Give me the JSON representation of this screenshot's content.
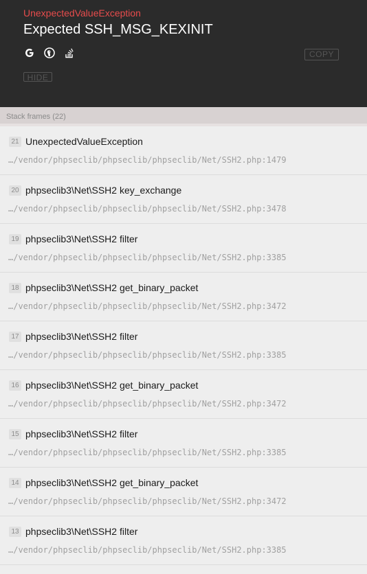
{
  "header": {
    "exception_class": "UnexpectedValueException",
    "exception_message": "Expected SSH_MSG_KEXINIT",
    "search_icons": [
      "google-icon",
      "duckduckgo-icon",
      "stackoverflow-icon"
    ],
    "copy_label": "COPY",
    "hide_label": "HIDE"
  },
  "stack": {
    "title": "Stack frames (22)",
    "frames": [
      {
        "index": "21",
        "title": "UnexpectedValueException",
        "file": "…/vendor/phpseclib/phpseclib/phpseclib/Net/SSH2.php:1479"
      },
      {
        "index": "20",
        "title": "phpseclib3\\Net\\SSH2 key_exchange",
        "file": "…/vendor/phpseclib/phpseclib/phpseclib/Net/SSH2.php:3478"
      },
      {
        "index": "19",
        "title": "phpseclib3\\Net\\SSH2 filter",
        "file": "…/vendor/phpseclib/phpseclib/phpseclib/Net/SSH2.php:3385"
      },
      {
        "index": "18",
        "title": "phpseclib3\\Net\\SSH2 get_binary_packet",
        "file": "…/vendor/phpseclib/phpseclib/phpseclib/Net/SSH2.php:3472"
      },
      {
        "index": "17",
        "title": "phpseclib3\\Net\\SSH2 filter",
        "file": "…/vendor/phpseclib/phpseclib/phpseclib/Net/SSH2.php:3385"
      },
      {
        "index": "16",
        "title": "phpseclib3\\Net\\SSH2 get_binary_packet",
        "file": "…/vendor/phpseclib/phpseclib/phpseclib/Net/SSH2.php:3472"
      },
      {
        "index": "15",
        "title": "phpseclib3\\Net\\SSH2 filter",
        "file": "…/vendor/phpseclib/phpseclib/phpseclib/Net/SSH2.php:3385"
      },
      {
        "index": "14",
        "title": "phpseclib3\\Net\\SSH2 get_binary_packet",
        "file": "…/vendor/phpseclib/phpseclib/phpseclib/Net/SSH2.php:3472"
      },
      {
        "index": "13",
        "title": "phpseclib3\\Net\\SSH2 filter",
        "file": "…/vendor/phpseclib/phpseclib/phpseclib/Net/SSH2.php:3385"
      }
    ]
  },
  "colors": {
    "header_bg": "#2b2b2b",
    "exception_class": "#e74c4c",
    "message": "#ffffff",
    "frames_header_bg": "#d8d2d2",
    "frame_bg": "#eeeeee"
  }
}
